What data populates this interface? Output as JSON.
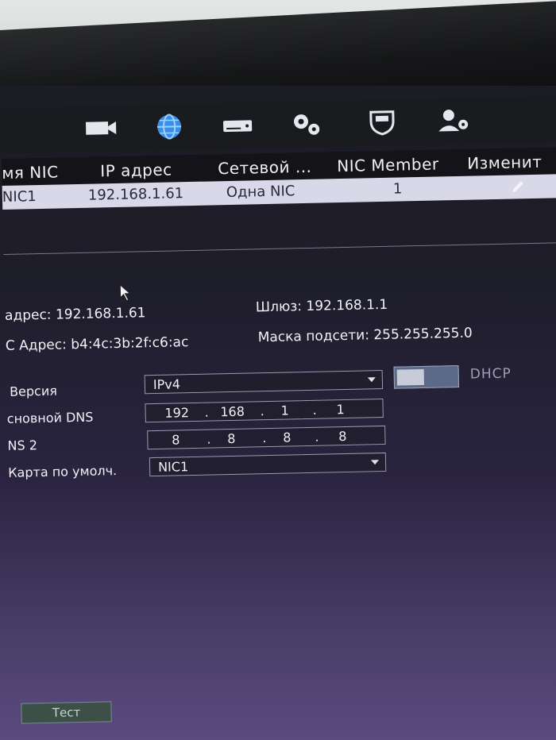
{
  "toolbar": {
    "icons": [
      "camera-icon",
      "network-globe-icon",
      "storage-icon",
      "settings-gears-icon",
      "security-shield-icon",
      "account-icon"
    ]
  },
  "grid": {
    "headers": [
      "мя NIC",
      "IP адрес",
      "Сетевой ...",
      "NIC Member",
      "Изменит"
    ],
    "rows": [
      {
        "nic": "NIC1",
        "ip": "192.168.1.61",
        "mode": "Одна NIC",
        "member": "1"
      }
    ]
  },
  "info": {
    "ip": "адрес: 192.168.1.61",
    "gateway": "Шлюз: 192.168.1.1",
    "mac": "С Адрес: b4:4c:3b:2f:c6:ac",
    "mask": "Маска подсети: 255.255.255.0"
  },
  "form": {
    "version_label": "Версия",
    "version_value": "IPv4",
    "dhcp_label": "DHCP",
    "dns1_label": "сновной DNS",
    "dns1": [
      "192",
      "168",
      "1",
      "1"
    ],
    "dns2_label": "NS 2",
    "dns2": [
      "8",
      "8",
      "8",
      "8"
    ],
    "default_card_label": "Карта по умолч.",
    "default_card_value": "NIC1"
  },
  "buttons": {
    "test": "Тест"
  },
  "colors": {
    "accent_globe": "#3a8ee8",
    "row_highlight": "#d8d8e8"
  }
}
